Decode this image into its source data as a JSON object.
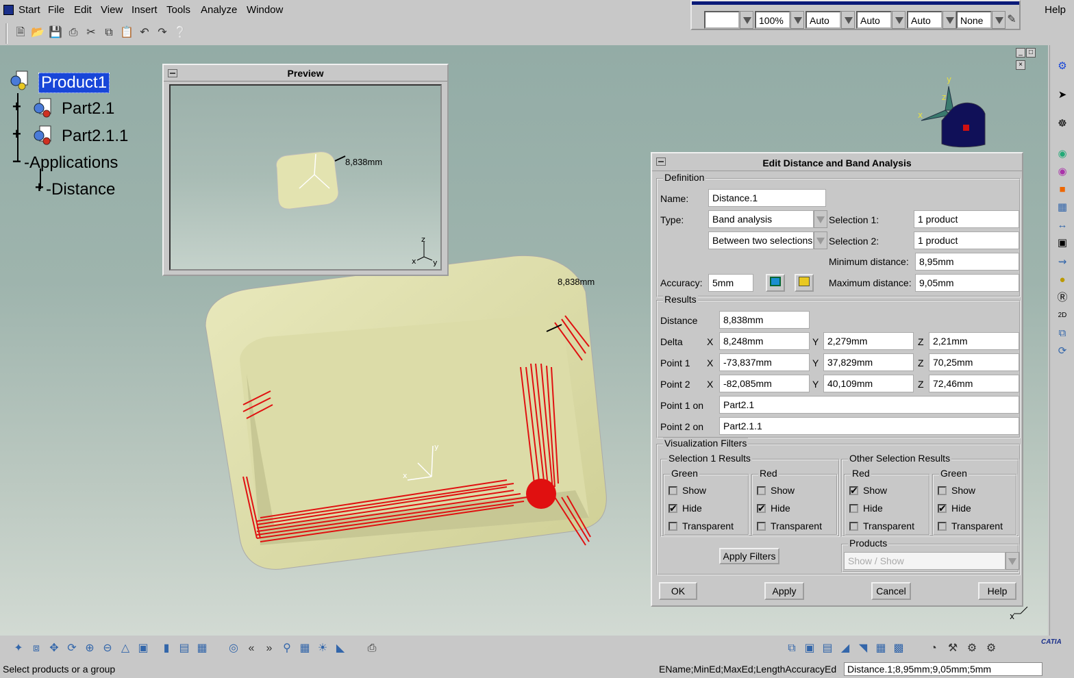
{
  "menu": {
    "items": [
      "Start",
      "File",
      "Edit",
      "View",
      "Insert",
      "Tools",
      "Analyze",
      "Window"
    ],
    "help": "Help"
  },
  "graphic_properties": {
    "color": "",
    "transparency": "100%",
    "line_thickness": "Auto",
    "line_type": "Auto",
    "point_type": "Auto",
    "layer": "None"
  },
  "tree": {
    "root": "Product1",
    "part1": "Part2.1",
    "part2": "Part2.1.1",
    "applications": "Applications",
    "distance": "Distance"
  },
  "preview": {
    "title": "Preview",
    "measure": "8,838mm"
  },
  "viewport": {
    "measure": "8,838mm"
  },
  "dialog": {
    "title": "Edit Distance and Band Analysis",
    "definition": {
      "label": "Definition",
      "name_label": "Name:",
      "name_value": "Distance.1",
      "type_label": "Type:",
      "type_value": "Band analysis",
      "mode_value": "Between two selections",
      "accuracy_label": "Accuracy:",
      "accuracy_value": "5mm",
      "selection1_label": "Selection 1:",
      "selection1_value": "1 product",
      "selection2_label": "Selection 2:",
      "selection2_value": "1 product",
      "min_label": "Minimum distance:",
      "min_value": "8,95mm",
      "max_label": "Maximum distance:",
      "max_value": "9,05mm"
    },
    "results": {
      "label": "Results",
      "distance_label": "Distance",
      "distance_value": "8,838mm",
      "delta_label": "Delta",
      "point1_label": "Point 1",
      "point2_label": "Point 2",
      "x": "X",
      "y": "Y",
      "z": "Z",
      "delta": {
        "x": "8,248mm",
        "y": "2,279mm",
        "z": "2,21mm"
      },
      "point1": {
        "x": "-73,837mm",
        "y": "37,829mm",
        "z": "70,25mm"
      },
      "point2": {
        "x": "-82,085mm",
        "y": "40,109mm",
        "z": "72,46mm"
      },
      "point1_on_label": "Point 1 on",
      "point1_on_value": "Part2.1",
      "point2_on_label": "Point 2 on",
      "point2_on_value": "Part2.1.1"
    },
    "filters": {
      "label": "Visualization Filters",
      "sel1_label": "Selection 1 Results",
      "other_label": "Other Selection Results",
      "green": "Green",
      "red": "Red",
      "show": "Show",
      "hide": "Hide",
      "transparent": "Transparent",
      "apply_filters": "Apply Filters",
      "products_label": "Products",
      "products_value": "Show / Show"
    },
    "buttons": {
      "ok": "OK",
      "apply": "Apply",
      "cancel": "Cancel",
      "help": "Help"
    }
  },
  "status": {
    "prompt": "Select products or a group",
    "keys": "EName;MinEd;MaxEd;LengthAccuracyEd",
    "value": "Distance.1;8,95mm;9,05mm;5mm"
  },
  "colors": {
    "band_red": "#e01010",
    "part_fill": "#e3e3b0",
    "title_blue": "#0a1a78",
    "selection": "#1846d8"
  }
}
